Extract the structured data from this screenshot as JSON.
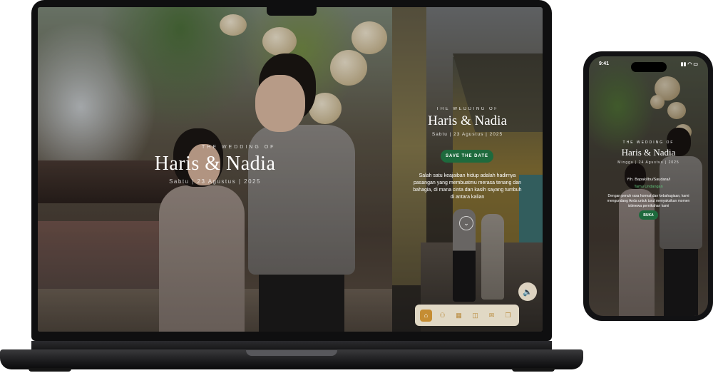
{
  "laptop": {
    "left_cover": {
      "kicker": "THE WEDDING OF",
      "names": "Haris & Nadia",
      "date": "Sabtu  |  23 Agustus  |  2025"
    },
    "right_panel": {
      "kicker": "THE WEDDING OF",
      "names": "Haris & Nadia",
      "date": "Sabtu  |  23 Agustus  |  2025",
      "save_button": "SAVE THE DATE",
      "quote": "Salah satu keajaiban hidup adalah hadirnya pasangan yang membuatmu merasa tenang dan bahagia, di mana cinta dan kasih sayang tumbuh di antara kalian",
      "scroll_icon": "chevron-down-icon",
      "sound_icon": "speaker-icon",
      "nav": [
        {
          "icon": "home-icon",
          "glyph": "⌂",
          "active": true
        },
        {
          "icon": "couple-icon",
          "glyph": "⚇",
          "active": false
        },
        {
          "icon": "calendar-icon",
          "glyph": "▦",
          "active": false
        },
        {
          "icon": "camera-icon",
          "glyph": "◫",
          "active": false
        },
        {
          "icon": "message-icon",
          "glyph": "✉",
          "active": false
        },
        {
          "icon": "gift-icon",
          "glyph": "❒",
          "active": false
        }
      ]
    }
  },
  "phone": {
    "status_time": "9:41",
    "status_icons": "▮▮ ◠ ▭",
    "kicker": "THE WEDDING OF",
    "names": "Haris & Nadia",
    "date": "Minggu  |  24 Agustus  |  2025",
    "to_label": "Yth. Bapak/Ibu/Saudara/i",
    "guest_name": "Tamu Undangan",
    "message": "Dengan penuh rasa hormat dan kebahagiaan, kami mengundang Anda untuk turut menyaksikan momen istimewa pernikahan kami",
    "open_button": "BUKA"
  },
  "colors": {
    "accent_green": "#1e6a3d",
    "accent_gold": "#c58d33",
    "guest_green": "#5fc27a"
  }
}
